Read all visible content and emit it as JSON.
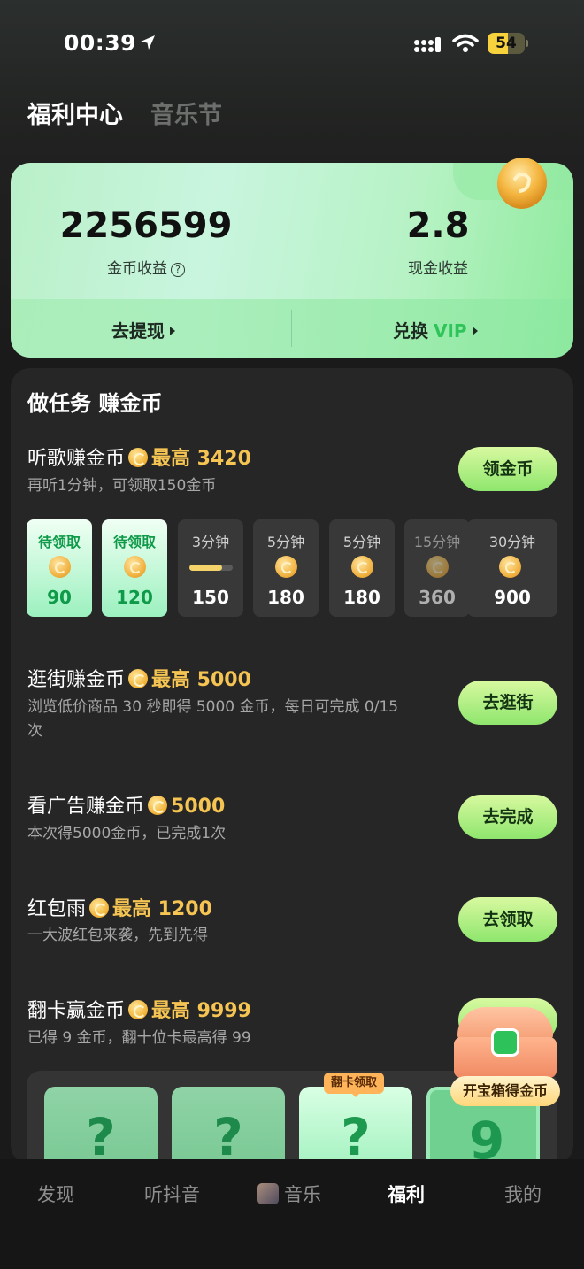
{
  "status": {
    "time": "00:39",
    "battery": "54",
    "battery_level": 0.54
  },
  "top_tabs": [
    {
      "label": "福利中心",
      "active": true
    },
    {
      "label": "音乐节",
      "active": false
    }
  ],
  "earnings": {
    "coins_value": "2256599",
    "coins_label": "金币收益",
    "cash_value": "2.8",
    "cash_label": "现金收益",
    "withdraw_label": "去提现",
    "exchange_label": "兑换",
    "exchange_vip": "VIP"
  },
  "tasks": {
    "panel_title": "做任务 赚金币",
    "listen": {
      "title": "听歌赚金币",
      "reward": "最高 3420",
      "sub": "再听1分钟，可领取150金币",
      "button": "领金币",
      "tiles": [
        {
          "label": "待领取",
          "value": "90",
          "state": "ready"
        },
        {
          "label": "待领取",
          "value": "120",
          "state": "ready"
        },
        {
          "label": "3分钟",
          "value": "150",
          "state": "progress",
          "progress": 0.75
        },
        {
          "label": "5分钟",
          "value": "180",
          "state": "locked"
        },
        {
          "label": "5分钟",
          "value": "180",
          "state": "locked"
        },
        {
          "label": "15分钟",
          "value": "360",
          "state": "dim"
        },
        {
          "label": "30分钟",
          "value": "900",
          "state": "locked"
        }
      ]
    },
    "shop": {
      "title": "逛街赚金币",
      "reward": "最高 5000",
      "sub_line1": "浏览低价商品 30 秒即得 5000 金币，每日可完成 0/15",
      "sub_line2": "次",
      "button": "去逛街"
    },
    "ads": {
      "title": "看广告赚金币",
      "reward": "5000",
      "sub": "本次得5000金币，已完成1次",
      "button": "去完成"
    },
    "redpack": {
      "title": "红包雨",
      "reward": "最高 1200",
      "sub": "一大波红包来袭，先到先得",
      "button": "去领取"
    },
    "flip": {
      "title": "翻卡赢金币",
      "reward": "最高 9999",
      "sub": "已得 9 金币，翻十位卡最高得 99",
      "tag": "翻卡领取",
      "cards": [
        "?",
        "?",
        "?",
        "9"
      ]
    }
  },
  "chest": {
    "label": "开宝箱得金币"
  },
  "bottom_nav": [
    {
      "label": "发现",
      "active": false
    },
    {
      "label": "听抖音",
      "active": false
    },
    {
      "label": "音乐",
      "active": false
    },
    {
      "label": "福利",
      "active": true
    },
    {
      "label": "我的",
      "active": false
    }
  ]
}
